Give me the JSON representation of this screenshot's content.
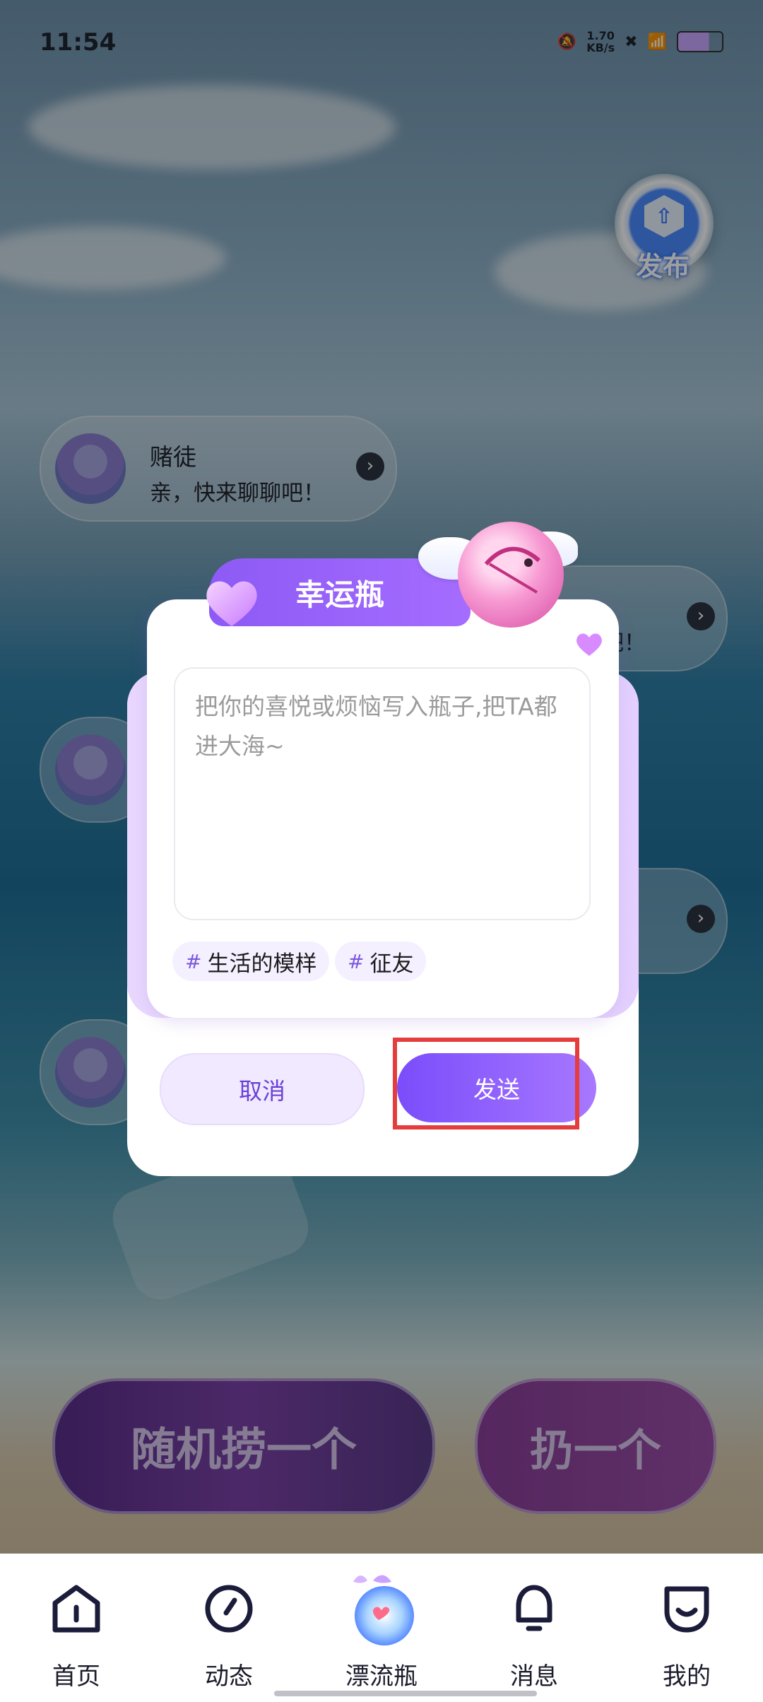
{
  "status_bar": {
    "time": "11:54",
    "net_speed_value": "1.70",
    "net_speed_unit": "KB/s"
  },
  "publish": {
    "label": "发布"
  },
  "bubbles": [
    {
      "name": "赌徒",
      "message": "亲，快来聊聊吧！"
    },
    {
      "message": "吧！"
    }
  ],
  "dialog": {
    "title": "幸运瓶",
    "placeholder": "把你的喜悦或烦恼写入瓶子,把TA都进大海~",
    "tags": [
      {
        "hash": "#",
        "label": "生活的模样"
      },
      {
        "hash": "#",
        "label": "征友"
      }
    ],
    "cancel_label": "取消",
    "send_label": "发送"
  },
  "actions": {
    "random_label": "随机捞一个",
    "throw_label": "扔一个"
  },
  "tabs": [
    {
      "label": "首页",
      "icon": "home-icon"
    },
    {
      "label": "动态",
      "icon": "compass-icon"
    },
    {
      "label": "漂流瓶",
      "icon": "bottle-icon"
    },
    {
      "label": "消息",
      "icon": "bell-icon"
    },
    {
      "label": "我的",
      "icon": "profile-icon"
    }
  ],
  "colors": {
    "accent": "#8d5af5",
    "highlight": "#e53c3c"
  }
}
